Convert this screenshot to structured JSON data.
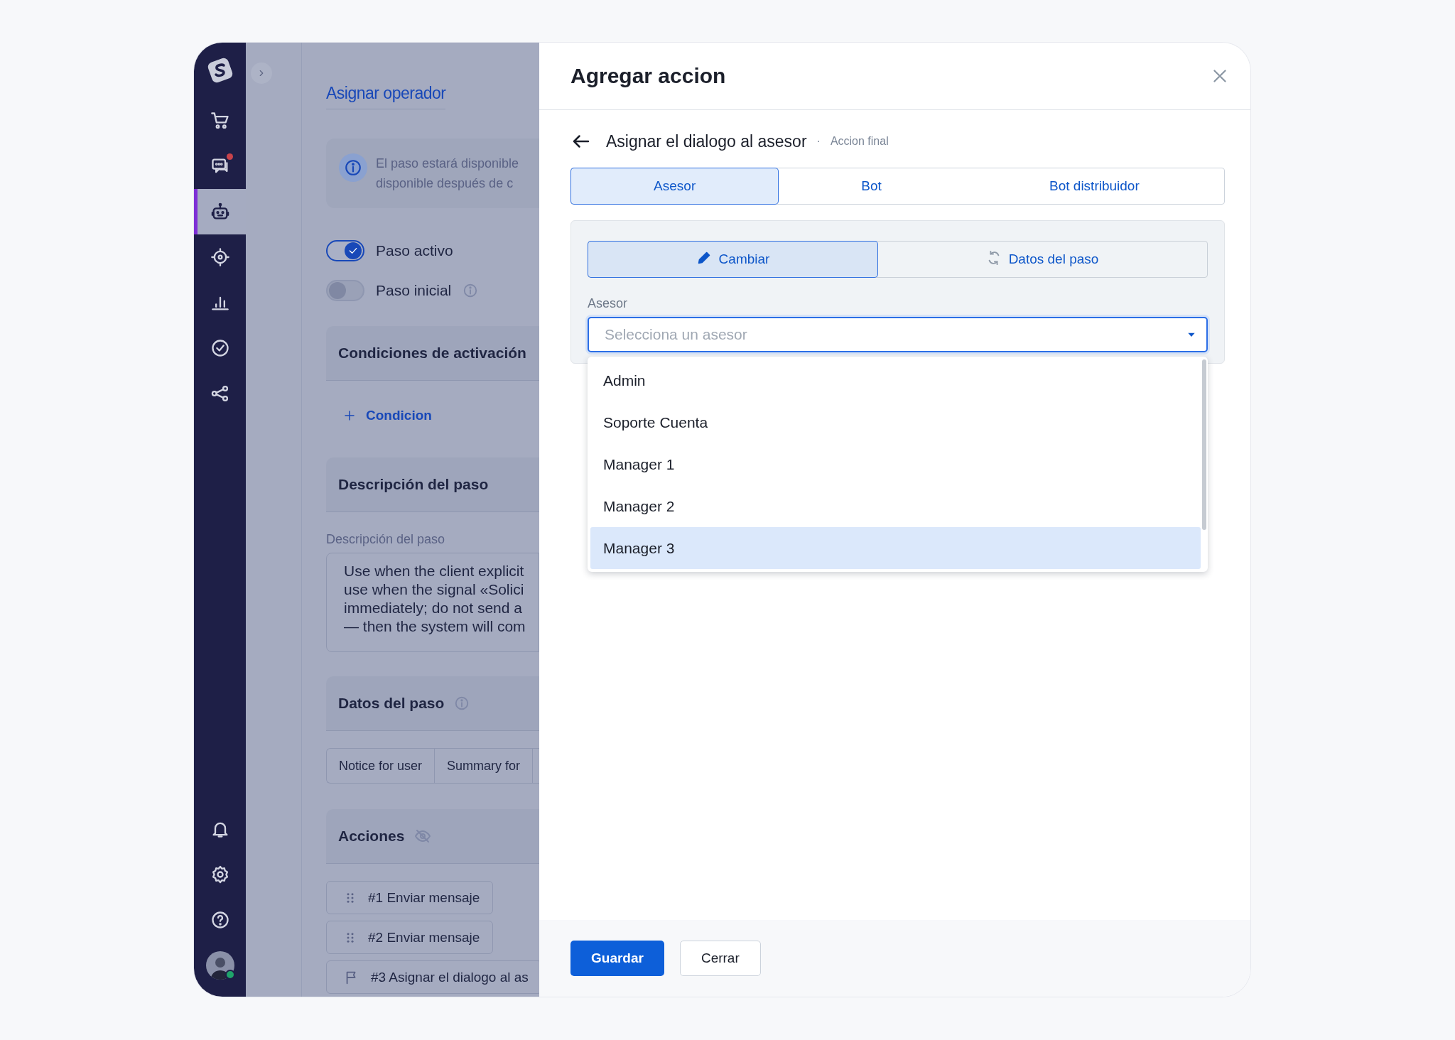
{
  "sidebar": {
    "items": [
      {
        "selected": false,
        "notification": false
      },
      {
        "selected": false,
        "notification": true
      },
      {
        "selected": true,
        "notification": false
      },
      {
        "selected": false,
        "notification": false
      },
      {
        "selected": false,
        "notification": false
      },
      {
        "selected": false,
        "notification": false
      },
      {
        "selected": false,
        "notification": false
      }
    ],
    "bottom_items": [
      {
        "selected": false
      },
      {
        "selected": false
      },
      {
        "selected": false
      }
    ],
    "avatar": {
      "online": true
    }
  },
  "background": {
    "title": "Asignar operador",
    "notice": [
      "El paso estará disponible",
      "disponible después de c"
    ],
    "toggles": [
      {
        "label": "Paso activo",
        "on": true,
        "info": false
      },
      {
        "label": "Paso inicial",
        "on": false,
        "info": true
      }
    ],
    "conditions": {
      "header": "Condiciones de activación",
      "add_link": "Condicion"
    },
    "description": {
      "header": "Descripción del paso",
      "label": "Descripción del paso",
      "lines": [
        "Use when the client explicit",
        "use when the signal «Solici",
        "immediately; do not send a",
        "— then the system will com"
      ]
    },
    "step_data": {
      "header": "Datos del paso",
      "tabs": [
        "Notice for user",
        "Summary for"
      ]
    },
    "actions": {
      "header": "Acciones",
      "items": [
        {
          "kind": "drag",
          "label": "#1 Enviar mensaje"
        },
        {
          "kind": "drag",
          "label": "#2 Enviar mensaje"
        },
        {
          "kind": "flag",
          "label": "#3 Asignar el dialogo al as"
        }
      ]
    }
  },
  "modal": {
    "title": "Agregar accion",
    "subtitle": "Asignar el dialogo al asesor",
    "separator": "·",
    "tag": "Accion final",
    "tabs": [
      {
        "label": "Asesor",
        "selected": true
      },
      {
        "label": "Bot",
        "selected": false
      },
      {
        "label": "Bot distribuidor",
        "selected": false
      }
    ],
    "segments": [
      {
        "label": "Cambiar",
        "selected": true
      },
      {
        "label": "Datos del paso",
        "selected": false
      }
    ],
    "field": {
      "label": "Asesor",
      "placeholder": "Selecciona un asesor"
    },
    "dropdown": {
      "options": [
        {
          "label": "Admin",
          "selected": false
        },
        {
          "label": "Soporte Cuenta",
          "selected": false
        },
        {
          "label": "Manager 1",
          "selected": false
        },
        {
          "label": "Manager 2",
          "selected": false
        },
        {
          "label": "Manager 3",
          "selected": true
        }
      ]
    },
    "buttons": [
      {
        "label": "Guardar",
        "kind": "primary"
      },
      {
        "label": "Cerrar",
        "kind": "secondary"
      }
    ]
  }
}
